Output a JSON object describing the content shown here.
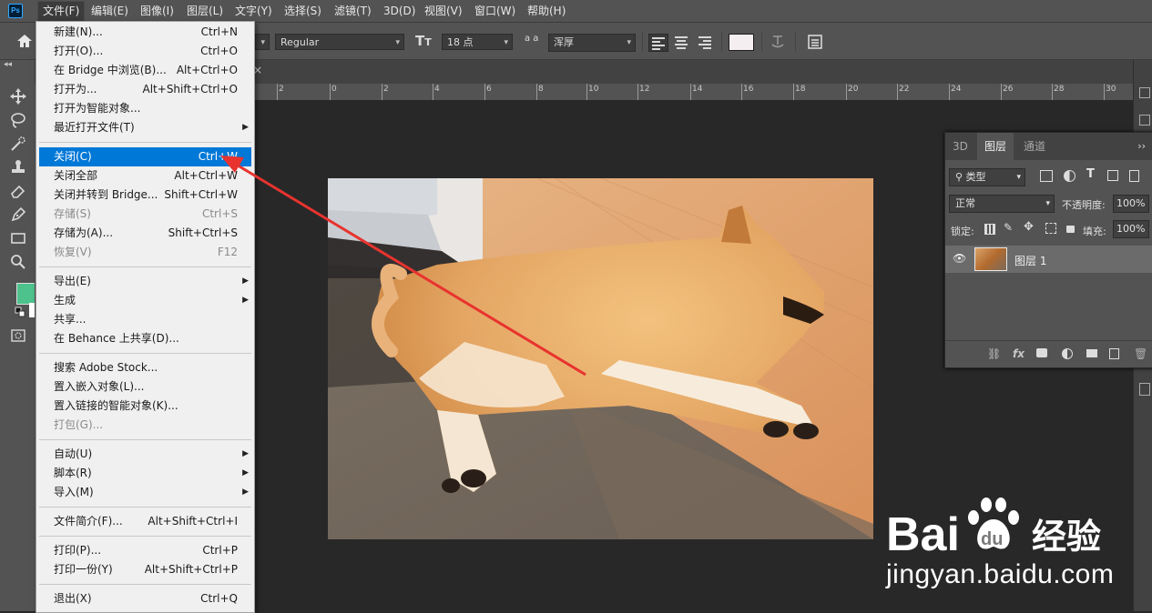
{
  "app": {
    "logo": "Ps"
  },
  "menubar": {
    "items": [
      "文件(F)",
      "编辑(E)",
      "图像(I)",
      "图层(L)",
      "文字(Y)",
      "选择(S)",
      "滤镜(T)",
      "3D(D)",
      "视图(V)",
      "窗口(W)",
      "帮助(H)"
    ],
    "active": "文件(F)"
  },
  "options_bar": {
    "font_style": "Regular",
    "font_size": "18 点",
    "aa_label": "a a",
    "antialias": "浑厚",
    "text_color": "#f5eef0"
  },
  "ruler": {
    "labels": [
      "2",
      "0",
      "2",
      "4",
      "6",
      "8",
      "10",
      "12",
      "14",
      "16",
      "18",
      "20",
      "22",
      "24",
      "26",
      "28",
      "30"
    ]
  },
  "file_menu": {
    "items": [
      {
        "label": "新建(N)...",
        "shortcut": "Ctrl+N"
      },
      {
        "label": "打开(O)...",
        "shortcut": "Ctrl+O"
      },
      {
        "label": "在 Bridge 中浏览(B)...",
        "shortcut": "Alt+Ctrl+O"
      },
      {
        "label": "打开为...",
        "shortcut": "Alt+Shift+Ctrl+O"
      },
      {
        "label": "打开为智能对象...",
        "shortcut": ""
      },
      {
        "label": "最近打开文件(T)",
        "shortcut": "",
        "submenu": true
      },
      {
        "sep": true
      },
      {
        "label": "关闭(C)",
        "shortcut": "Ctrl+W",
        "highlight": true
      },
      {
        "label": "关闭全部",
        "shortcut": "Alt+Ctrl+W"
      },
      {
        "label": "关闭并转到 Bridge...",
        "shortcut": "Shift+Ctrl+W"
      },
      {
        "label": "存储(S)",
        "shortcut": "Ctrl+S",
        "disabled": true
      },
      {
        "label": "存储为(A)...",
        "shortcut": "Shift+Ctrl+S"
      },
      {
        "label": "恢复(V)",
        "shortcut": "F12",
        "disabled": true
      },
      {
        "sep": true
      },
      {
        "label": "导出(E)",
        "shortcut": "",
        "submenu": true
      },
      {
        "label": "生成",
        "shortcut": "",
        "submenu": true
      },
      {
        "label": "共享...",
        "shortcut": ""
      },
      {
        "label": "在 Behance 上共享(D)...",
        "shortcut": ""
      },
      {
        "sep": true
      },
      {
        "label": "搜索 Adobe Stock...",
        "shortcut": ""
      },
      {
        "label": "置入嵌入对象(L)...",
        "shortcut": ""
      },
      {
        "label": "置入链接的智能对象(K)...",
        "shortcut": ""
      },
      {
        "label": "打包(G)...",
        "shortcut": "",
        "disabled": true
      },
      {
        "sep": true
      },
      {
        "label": "自动(U)",
        "shortcut": "",
        "submenu": true
      },
      {
        "label": "脚本(R)",
        "shortcut": "",
        "submenu": true
      },
      {
        "label": "导入(M)",
        "shortcut": "",
        "submenu": true
      },
      {
        "sep": true
      },
      {
        "label": "文件简介(F)...",
        "shortcut": "Alt+Shift+Ctrl+I"
      },
      {
        "sep": true
      },
      {
        "label": "打印(P)...",
        "shortcut": "Ctrl+P"
      },
      {
        "label": "打印一份(Y)",
        "shortcut": "Alt+Shift+Ctrl+P"
      },
      {
        "sep": true
      },
      {
        "label": "退出(X)",
        "shortcut": "Ctrl+Q"
      }
    ]
  },
  "layers_panel": {
    "tabs": [
      "3D",
      "图层",
      "通道"
    ],
    "active_tab": "图层",
    "filter_kind": "类型",
    "blend_mode": "正常",
    "opacity_label": "不透明度:",
    "opacity_value": "100%",
    "lock_label": "锁定:",
    "fill_label": "填充:",
    "fill_value": "100%",
    "layer_name": "图层 1",
    "footer_fx": "fx"
  },
  "watermark": {
    "brand": "Bai 经验",
    "url": "jingyan.baidu.com"
  },
  "colors": {
    "foreground": "#4ec28c",
    "background": "#ffffff",
    "highlight": "#0078d7",
    "arrow": "#e8332f"
  }
}
